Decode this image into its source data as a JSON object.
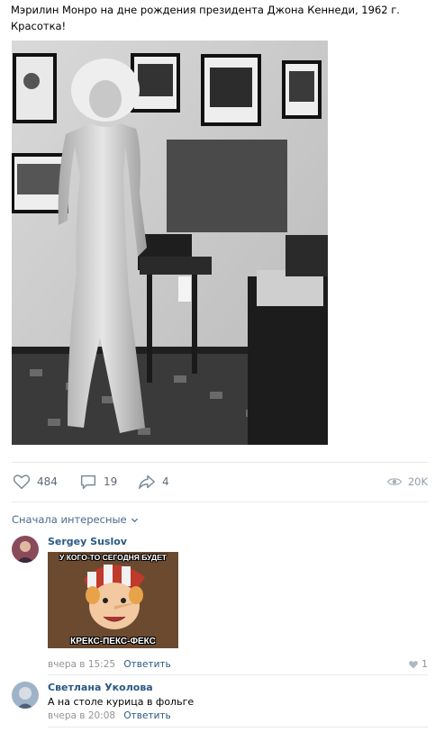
{
  "post": {
    "text_line1": "Мэрилин Монро на дне рождения президента Джона Кеннеди, 1962 г.",
    "text_line2": "Красотка!"
  },
  "actions": {
    "likes": "484",
    "comments": "19",
    "shares": "4",
    "views": "20K"
  },
  "comments_section": {
    "sort_label": "Сначала интересные"
  },
  "comments": [
    {
      "author": "Sergey Suslov",
      "meme_top": "У КОГО-ТО СЕГОДНЯ БУДЕТ",
      "meme_bottom": "КРЕКС-ПЕКС-ФЕКС",
      "time": "вчера в 15:25",
      "reply": "Ответить",
      "likes": "1"
    },
    {
      "author": "Светлана Уколова",
      "text": "А на столе курица в фольге",
      "time": "вчера в 20:08",
      "reply": "Ответить"
    }
  ],
  "colors": {
    "link": "#2a5885",
    "icon": "#5d6a79",
    "muted": "#939393",
    "divider": "#e7e8ec"
  }
}
